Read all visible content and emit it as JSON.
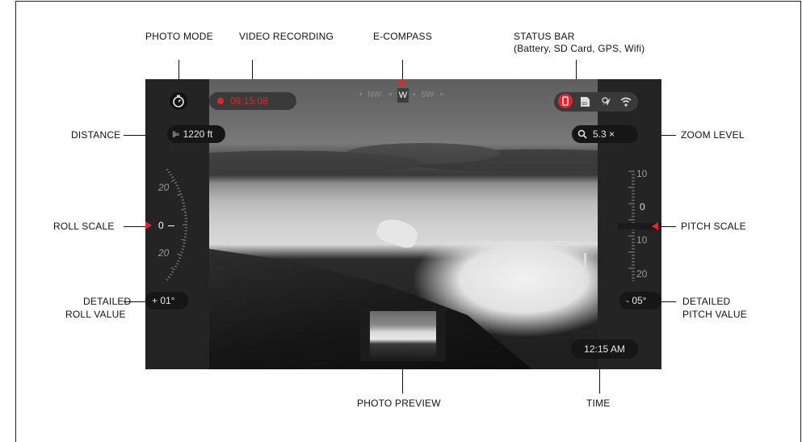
{
  "callouts": {
    "photo_mode": "PHOTO MODE",
    "video_recording": "VIDEO RECORDING",
    "e_compass": "E-COMPASS",
    "status_bar_title": "STATUS BAR",
    "status_bar_sub": "(Battery, SD Card, GPS, Wifi)",
    "distance": "DISTANCE",
    "zoom_level": "ZOOM LEVEL",
    "roll_scale": "ROLL SCALE",
    "pitch_scale": "PITCH SCALE",
    "detailed_roll_1": "DETAILED",
    "detailed_roll_2": "ROLL VALUE",
    "detailed_pitch_1": "DETAILED",
    "detailed_pitch_2": "PITCH VALUE",
    "photo_preview": "PHOTO PREVIEW",
    "time": "TIME"
  },
  "hud": {
    "recording_time": "09:15:08",
    "compass": {
      "left": "NW",
      "center": "W",
      "right": "SW"
    },
    "distance": "1220 ft",
    "zoom": "5.3 ×",
    "roll_labels": {
      "top": "20",
      "current": "0",
      "bottom": "20"
    },
    "pitch_labels": {
      "top": "10",
      "mid": "0",
      "below": "10",
      "bottom": "20"
    },
    "roll_value": "+ 01°",
    "pitch_value": "- 05°",
    "clock": "12:15 AM",
    "status_icons": [
      "battery-icon",
      "sd-card-icon",
      "gps-icon",
      "wifi-icon"
    ]
  },
  "colors": {
    "accent_red": "#e0262f",
    "panel": "#242424",
    "pill": "#161616"
  }
}
